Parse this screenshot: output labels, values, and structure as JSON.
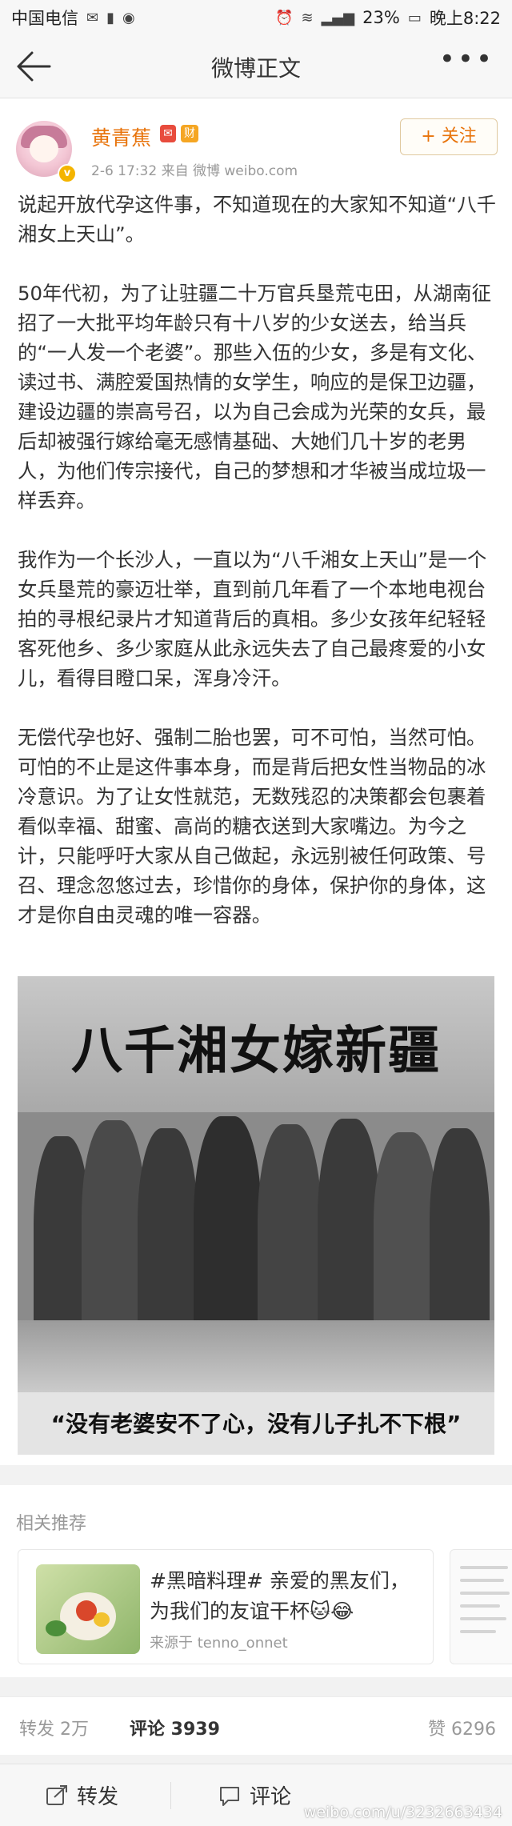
{
  "status_bar": {
    "carrier": "中国电信",
    "battery": "23%",
    "time": "晚上8:22"
  },
  "nav": {
    "title": "微博正文"
  },
  "post": {
    "author": "黄青蕉",
    "badge_caifu": "财",
    "meta": "2-6 17:32  来自 微博 weibo.com",
    "follow_label": "+ 关注",
    "paragraphs": [
      "说起开放代孕这件事，不知道现在的大家知不知道“八千湘女上天山”。",
      "50年代初，为了让驻疆二十万官兵垦荒屯田，从湖南征招了一大批平均年龄只有十八岁的少女送去，给当兵的“一人发一个老婆”。那些入伍的少女，多是有文化、读过书、满腔爱国热情的女学生，响应的是保卫边疆，建设边疆的崇高号召，以为自己会成为光荣的女兵，最后却被强行嫁给毫无感情基础、大她们几十岁的老男人，为他们传宗接代，自己的梦想和才华被当成垃圾一样丢弃。",
      "我作为一个长沙人，一直以为“八千湘女上天山”是一个女兵垦荒的豪迈壮举，直到前几年看了一个本地电视台拍的寻根纪录片才知道背后的真相。多少女孩年纪轻轻客死他乡、多少家庭从此永远失去了自己最疼爱的小女儿，看得目瞪口呆，浑身冷汗。",
      "无偿代孕也好、强制二胎也罢，可不可怕，当然可怕。可怕的不止是这件事本身，而是背后把女性当物品的冰冷意识。为了让女性就范，无数残忍的决策都会包裹着看似幸福、甜蜜、高尚的糖衣送到大家嘴边。为今之计，只能呼吁大家从自己做起，永远别被任何政策、号召、理念忽悠过去，珍惜你的身体，保护你的身体，这才是你自由灵魂的唯一容器。"
    ],
    "image": {
      "headline": "八千湘女嫁新疆",
      "caption": "“没有老婆安不了心，没有儿子扎不下根”"
    }
  },
  "related": {
    "title": "相关推荐",
    "card": {
      "text": "#黑暗料理# 亲爱的黑友们，为我们的友谊干杯🐱😂",
      "source": "来源于 tenno_onnet"
    }
  },
  "stats": {
    "reposts": "转发 2万",
    "comments": "评论 3939",
    "likes": "赞 6296"
  },
  "bottom_bar": {
    "repost": "转发",
    "comment": "评论",
    "watermark": "weibo.com/u/3232663434"
  }
}
